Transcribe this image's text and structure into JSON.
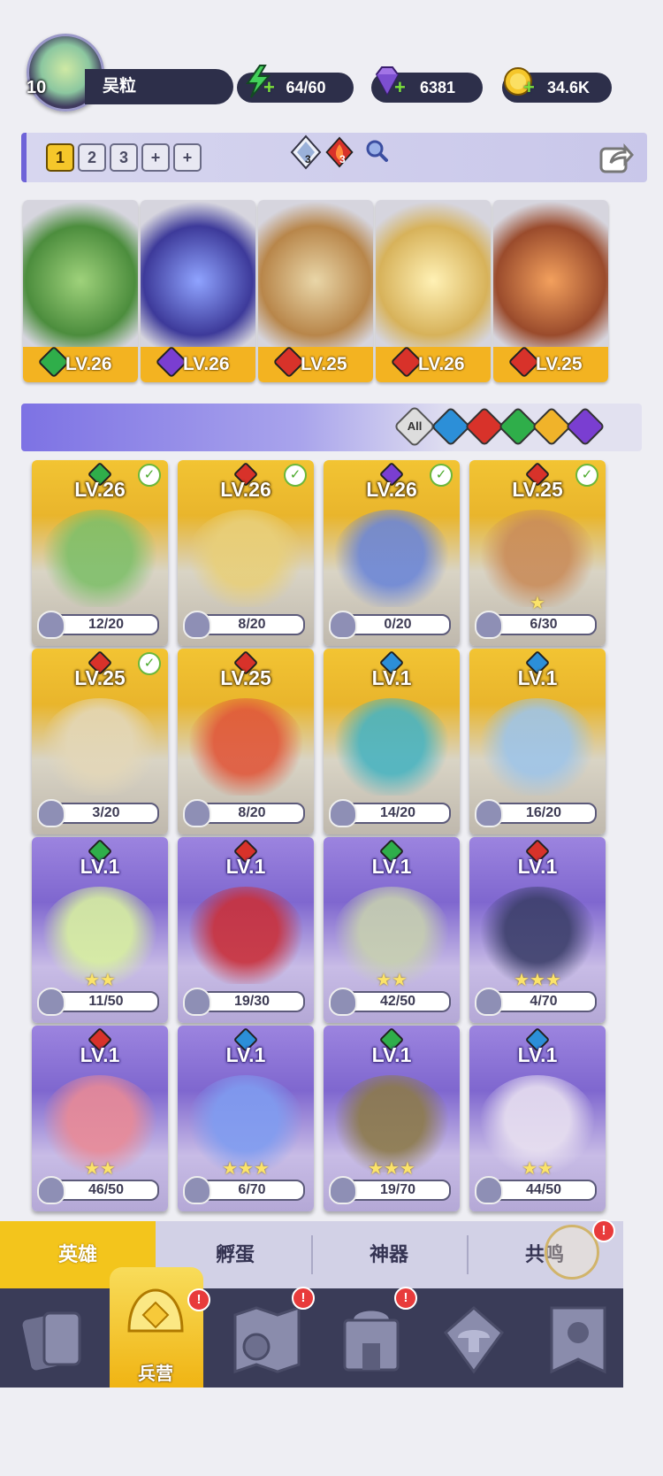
{
  "profile": {
    "level": "10",
    "name": "吴粒"
  },
  "resources": {
    "energy": "64/60",
    "gems": "6381",
    "gold": "34.6K"
  },
  "team_bar": {
    "slots": [
      "1",
      "2",
      "3",
      "+",
      "+"
    ],
    "active_slot": "1",
    "crystal_count": "3",
    "fire_count": "3"
  },
  "team": [
    {
      "element": "earth",
      "level": "LV.26"
    },
    {
      "element": "shadow",
      "level": "LV.26"
    },
    {
      "element": "fire",
      "level": "LV.25"
    },
    {
      "element": "fire",
      "level": "LV.26"
    },
    {
      "element": "fire",
      "level": "LV.25"
    }
  ],
  "filters": {
    "all_label": "All",
    "elements": [
      "water",
      "fire",
      "earth",
      "light",
      "shadow"
    ]
  },
  "heroes": [
    {
      "level": "LV.26",
      "element": "earth",
      "progress": "12/20",
      "selected": true,
      "rarity": "gold",
      "stars": 0
    },
    {
      "level": "LV.26",
      "element": "fire",
      "progress": "8/20",
      "selected": true,
      "rarity": "gold",
      "stars": 0
    },
    {
      "level": "LV.26",
      "element": "shadow",
      "progress": "0/20",
      "selected": true,
      "rarity": "gold",
      "stars": 0
    },
    {
      "level": "LV.25",
      "element": "fire",
      "progress": "6/30",
      "selected": true,
      "rarity": "gold",
      "stars": 1
    },
    {
      "level": "LV.25",
      "element": "fire",
      "progress": "3/20",
      "selected": true,
      "rarity": "gold",
      "stars": 0
    },
    {
      "level": "LV.25",
      "element": "fire",
      "progress": "8/20",
      "selected": false,
      "rarity": "gold",
      "stars": 0
    },
    {
      "level": "LV.1",
      "element": "water",
      "progress": "14/20",
      "selected": false,
      "rarity": "gold",
      "stars": 0
    },
    {
      "level": "LV.1",
      "element": "water",
      "progress": "16/20",
      "selected": false,
      "rarity": "gold",
      "stars": 0
    },
    {
      "level": "LV.1",
      "element": "earth",
      "progress": "11/50",
      "selected": false,
      "rarity": "purple",
      "stars": 2
    },
    {
      "level": "LV.1",
      "element": "fire",
      "progress": "19/30",
      "selected": false,
      "rarity": "purple",
      "stars": 0
    },
    {
      "level": "LV.1",
      "element": "earth",
      "progress": "42/50",
      "selected": false,
      "rarity": "purple",
      "stars": 2
    },
    {
      "level": "LV.1",
      "element": "fire",
      "progress": "4/70",
      "selected": false,
      "rarity": "purple",
      "stars": 3
    },
    {
      "level": "LV.1",
      "element": "fire",
      "progress": "46/50",
      "selected": false,
      "rarity": "purple",
      "stars": 2
    },
    {
      "level": "LV.1",
      "element": "water",
      "progress": "6/70",
      "selected": false,
      "rarity": "purple",
      "stars": 3
    },
    {
      "level": "LV.1",
      "element": "earth",
      "progress": "19/70",
      "selected": false,
      "rarity": "purple",
      "stars": 3
    },
    {
      "level": "LV.1",
      "element": "water",
      "progress": "44/50",
      "selected": false,
      "rarity": "purple",
      "stars": 2
    }
  ],
  "subtabs": [
    "英雄",
    "孵蛋",
    "神器",
    "共鸣"
  ],
  "nav": {
    "active_label": "兵营",
    "items": [
      "cards-icon",
      "barracks-icon",
      "map-icon",
      "castle-icon",
      "mushroom-icon",
      "banner-icon"
    ]
  },
  "colors": {
    "earth": "#2fae4a",
    "fire": "#d8322a",
    "water": "#2c8fd8",
    "shadow": "#7a3ed1",
    "light": "#f0b32a",
    "gold_accent": "#f3c51c"
  }
}
